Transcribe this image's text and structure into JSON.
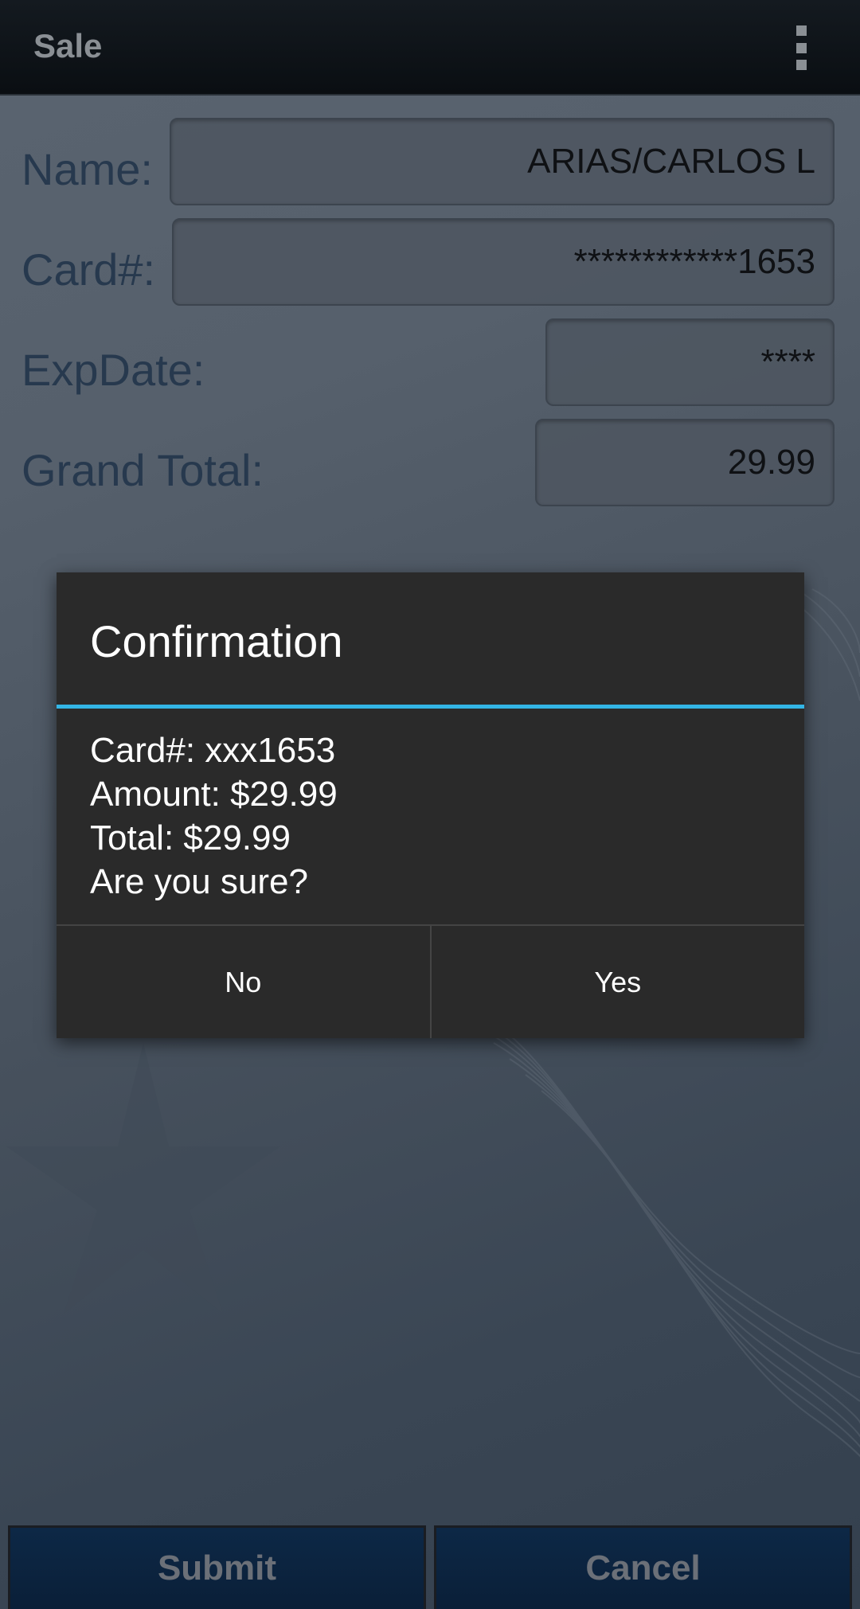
{
  "action_bar": {
    "title": "Sale",
    "overflow_icon": "more-vert-icon"
  },
  "form": {
    "name": {
      "label": "Name:",
      "value": "ARIAS/CARLOS L"
    },
    "card": {
      "label": "Card#:",
      "value": "************1653"
    },
    "exp_date": {
      "label": "ExpDate:",
      "value": "****"
    },
    "grand_total": {
      "label": "Grand Total:",
      "value": "29.99"
    }
  },
  "dialog": {
    "title": "Confirmation",
    "message_lines": [
      "Card#: xxx1653",
      "Amount: $29.99",
      "Total: $29.99",
      "Are you sure?"
    ],
    "no_label": "No",
    "yes_label": "Yes",
    "accent_color": "#33b5e5"
  },
  "bottom_bar": {
    "submit_label": "Submit",
    "cancel_label": "Cancel"
  }
}
